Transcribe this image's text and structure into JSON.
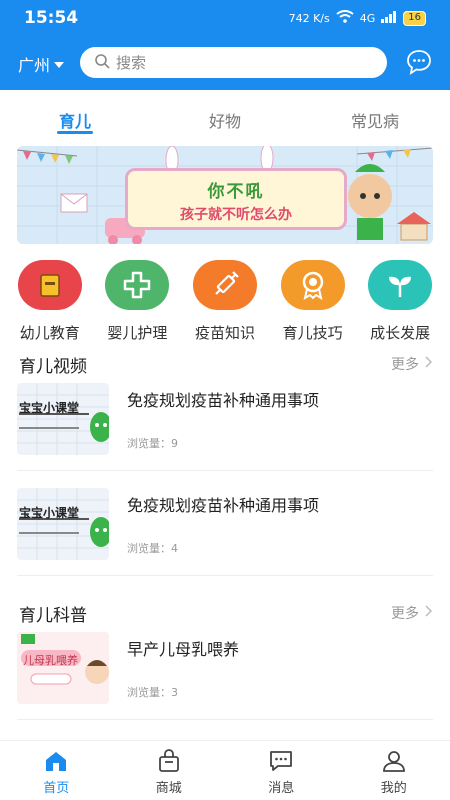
{
  "status": {
    "time": "15:54",
    "network": "4G",
    "speed": "742 K/s",
    "battery": "16"
  },
  "header": {
    "city": "广州",
    "search_placeholder": "搜索"
  },
  "tabs": [
    {
      "label": "育儿"
    },
    {
      "label": "好物"
    },
    {
      "label": "常见病"
    }
  ],
  "banner": {
    "line1": "你不吼",
    "line2": "孩子就不听怎么办"
  },
  "categories": [
    {
      "label": "幼儿教育",
      "color": "#e8454a",
      "icon": "book-icon"
    },
    {
      "label": "婴儿护理",
      "color": "#4fb56b",
      "icon": "medical-cross-icon"
    },
    {
      "label": "疫苗知识",
      "color": "#f47b2a",
      "icon": "syringe-icon"
    },
    {
      "label": "育儿技巧",
      "color": "#f39a2b",
      "icon": "award-icon"
    },
    {
      "label": "成长发展",
      "color": "#2bc2b7",
      "icon": "sprout-icon"
    }
  ],
  "video_section": {
    "title": "育儿视频",
    "more": "更多",
    "items": [
      {
        "title": "免疫规划疫苗补种通用事项",
        "views": "浏览量：9",
        "thumb_text": "宝宝小课堂"
      },
      {
        "title": "免疫规划疫苗补种通用事项",
        "views": "浏览量：4",
        "thumb_text": "宝宝小课堂"
      }
    ]
  },
  "science_section": {
    "title": "育儿科普",
    "more": "更多",
    "items": [
      {
        "title": "早产儿母乳喂养",
        "views": "浏览量：3",
        "thumb_text": "儿母乳喂养"
      }
    ]
  },
  "bottom_nav": [
    {
      "label": "首页",
      "icon": "home-icon"
    },
    {
      "label": "商城",
      "icon": "shopping-bag-icon"
    },
    {
      "label": "消息",
      "icon": "message-icon"
    },
    {
      "label": "我的",
      "icon": "user-icon"
    }
  ],
  "colors": {
    "primary": "#1a8cf0",
    "muted": "#999999"
  }
}
